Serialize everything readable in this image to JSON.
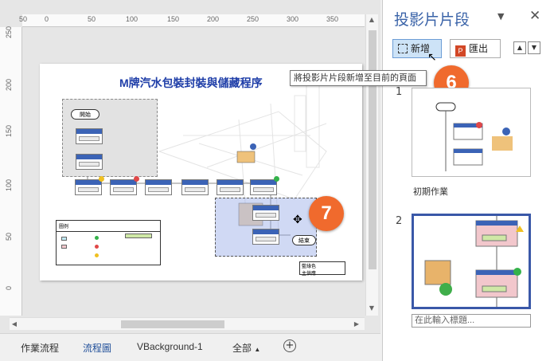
{
  "canvas": {
    "ruler_top_labels": [
      "50",
      "0",
      "50",
      "100",
      "150",
      "200",
      "250",
      "300",
      "350"
    ],
    "ruler_left_labels": [
      "250",
      "200",
      "150",
      "100",
      "50",
      "0"
    ],
    "diagram": {
      "title": "M牌汽水包裝封裝與儲藏程序",
      "start_label": "開始",
      "end_label": "結束",
      "legend_title": "圖例",
      "note_line1": "藍綠色",
      "note_line2": "主供應"
    },
    "badge_7": "7"
  },
  "tabs": {
    "items": [
      "作業流程",
      "流程圖",
      "VBackground-1",
      "全部"
    ],
    "active_index": 1,
    "add_symbol": "+"
  },
  "pane": {
    "title": "投影片片段",
    "buttons": {
      "new_label": "新增",
      "export_label": "匯出"
    },
    "tooltip": "將投影片片段新增至目前的頁面",
    "badge_6": "6",
    "snippets": [
      {
        "number": "1",
        "caption": "初期作業"
      },
      {
        "number": "2",
        "caption": ""
      }
    ],
    "caption_placeholder": "在此輸入標題...",
    "colors": {
      "title": "#3a63a8",
      "badge": "#f06a2d",
      "selected_border": "#3a58a8"
    }
  }
}
